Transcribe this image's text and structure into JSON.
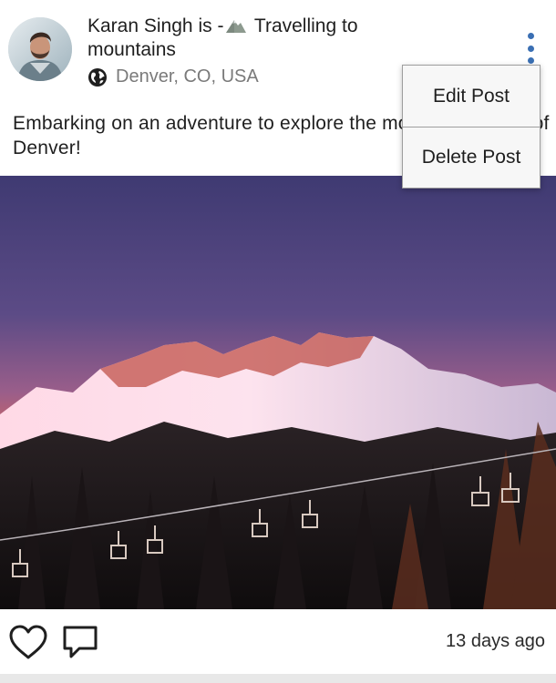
{
  "post": {
    "author_name": "Karan Singh",
    "status_prefix": "is -",
    "activity": "Travelling to mountains",
    "location": "Denver, CO, USA",
    "caption": "Embarking on an adventure to explore the mountain ranges of Denver!",
    "timestamp": "13 days ago"
  },
  "menu": {
    "items": [
      "Edit Post",
      "Delete Post"
    ]
  },
  "icons": {
    "avatar": "profile-photo",
    "activity": "mountain-emoji",
    "location": "globe-icon",
    "more": "vertical-ellipsis-icon",
    "like": "heart-outline-icon",
    "comment": "comment-bubble-icon"
  },
  "colors": {
    "accent": "#3a6fb3",
    "muted_text": "#7a7a7a",
    "menu_background": "#f7f7f7"
  }
}
